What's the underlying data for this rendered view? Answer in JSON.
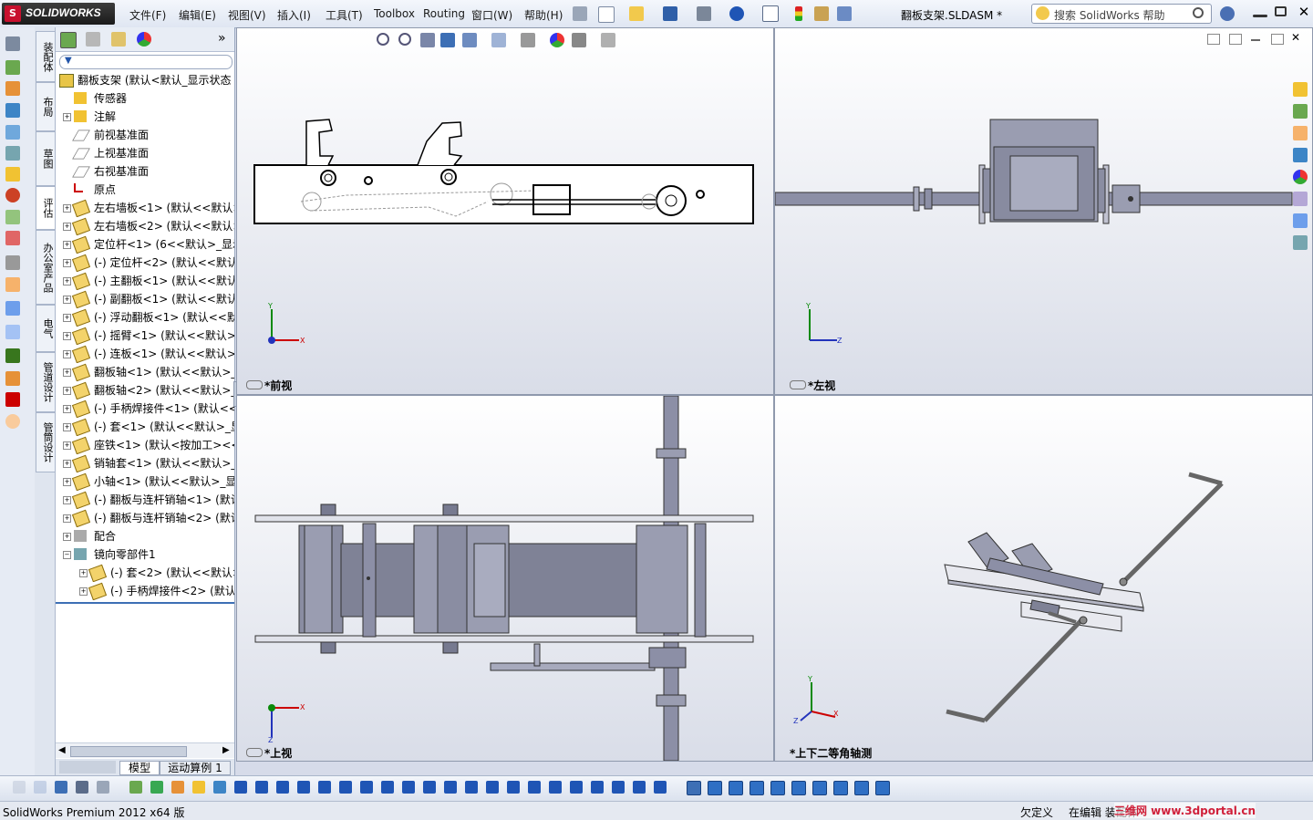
{
  "app": {
    "name": "SOLIDWORKS",
    "brand_color": "#c8102e"
  },
  "menu": [
    "文件(F)",
    "编辑(E)",
    "视图(V)",
    "插入(I)",
    "工具(T)",
    "Toolbox",
    "Routing",
    "窗口(W)",
    "帮助(H)"
  ],
  "document_title": "翻板支架.SLDASM *",
  "search": {
    "placeholder": "搜索 SolidWorks 帮助"
  },
  "left_tabs": [
    "装配体",
    "布局",
    "草图",
    "评估",
    "办公室产品",
    "电气",
    "管道设计",
    "管筒设计"
  ],
  "feature_tree": {
    "root": "翻板支架  (默认<默认_显示状态",
    "items": [
      {
        "label": "传感器",
        "expand": false,
        "indent": 1,
        "icon": "sensor-icon"
      },
      {
        "label": "注解",
        "expand": true,
        "indent": 1,
        "icon": "annotation-icon"
      },
      {
        "label": "前视基准面",
        "expand": false,
        "indent": 1,
        "icon": "plane-icon"
      },
      {
        "label": "上视基准面",
        "expand": false,
        "indent": 1,
        "icon": "plane-icon"
      },
      {
        "label": "右视基准面",
        "expand": false,
        "indent": 1,
        "icon": "plane-icon"
      },
      {
        "label": "原点",
        "expand": false,
        "indent": 1,
        "icon": "origin-icon"
      },
      {
        "label": "左右墙板<1> (默认<<默认>",
        "expand": true,
        "indent": 1,
        "icon": "part-icon"
      },
      {
        "label": "左右墙板<2> (默认<<默认>",
        "expand": true,
        "indent": 1,
        "icon": "part-icon"
      },
      {
        "label": "定位杆<1> (6<<默认>_显示",
        "expand": true,
        "indent": 1,
        "icon": "part-icon"
      },
      {
        "label": "(-) 定位杆<2> (默认<<默认",
        "expand": true,
        "indent": 1,
        "icon": "part-icon"
      },
      {
        "label": "(-) 主翻板<1> (默认<<默认",
        "expand": true,
        "indent": 1,
        "icon": "part-icon"
      },
      {
        "label": "(-) 副翻板<1> (默认<<默认",
        "expand": true,
        "indent": 1,
        "icon": "part-icon"
      },
      {
        "label": "(-) 浮动翻板<1> (默认<<默",
        "expand": true,
        "indent": 1,
        "icon": "part-icon"
      },
      {
        "label": "(-) 摇臂<1> (默认<<默认>_",
        "expand": true,
        "indent": 1,
        "icon": "part-icon"
      },
      {
        "label": "(-) 连板<1> (默认<<默认>_",
        "expand": true,
        "indent": 1,
        "icon": "part-icon"
      },
      {
        "label": "翻板轴<1> (默认<<默认>_显",
        "expand": true,
        "indent": 1,
        "icon": "part-icon"
      },
      {
        "label": "翻板轴<2> (默认<<默认>_显",
        "expand": true,
        "indent": 1,
        "icon": "part-icon"
      },
      {
        "label": "(-) 手柄焊接件<1> (默认<<",
        "expand": true,
        "indent": 1,
        "icon": "part-icon"
      },
      {
        "label": "(-) 套<1> (默认<<默认>_显",
        "expand": true,
        "indent": 1,
        "icon": "part-icon"
      },
      {
        "label": "座铁<1> (默认<按加工><<",
        "expand": true,
        "indent": 1,
        "icon": "part-icon"
      },
      {
        "label": "销轴套<1> (默认<<默认>_显",
        "expand": true,
        "indent": 1,
        "icon": "part-icon"
      },
      {
        "label": "小轴<1> (默认<<默认>_显示",
        "expand": true,
        "indent": 1,
        "icon": "part-icon"
      },
      {
        "label": "(-) 翻板与连杆销轴<1> (默认",
        "expand": true,
        "indent": 1,
        "icon": "part-icon"
      },
      {
        "label": "(-) 翻板与连杆销轴<2> (默认",
        "expand": true,
        "indent": 1,
        "icon": "part-icon"
      },
      {
        "label": "配合",
        "expand": true,
        "indent": 1,
        "icon": "mate-icon"
      },
      {
        "label": "镜向零部件1",
        "expand": "open",
        "indent": 1,
        "icon": "mirror-icon"
      },
      {
        "label": "(-) 套<2> (默认<<默认>_",
        "expand": true,
        "indent": 2,
        "icon": "part-icon"
      },
      {
        "label": "(-) 手柄焊接件<2> (默认",
        "expand": true,
        "indent": 2,
        "icon": "part-icon"
      }
    ]
  },
  "bottom_tabs": [
    "模型",
    "运动算例 1"
  ],
  "viewports": {
    "front": "*前视",
    "left": "*左视",
    "top": "*上视",
    "iso": "*上下二等角轴测"
  },
  "triad": {
    "x": "X",
    "y": "Y",
    "z": "Z"
  },
  "status": {
    "left": "SolidWorks Premium 2012 x64 版",
    "mid": "欠定义",
    "right": "在编辑 装配体",
    "watermark": "三维网 www.3dportal.cn"
  }
}
